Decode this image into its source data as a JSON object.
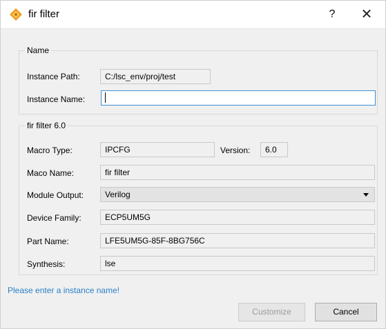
{
  "window": {
    "title": "fir filter",
    "help": "?",
    "close": "✕"
  },
  "name_group": {
    "legend": "Name",
    "instance_path_label": "Instance Path:",
    "instance_path_value": "C:/lsc_env/proj/test",
    "instance_name_label": "Instance Name:",
    "instance_name_value": ""
  },
  "fir_group": {
    "legend": "fir filter 6.0",
    "macro_type_label": "Macro Type:",
    "macro_type_value": "IPCFG",
    "version_label": "Version:",
    "version_value": "6.0",
    "maco_name_label": "Maco Name:",
    "maco_name_value": "fir filter",
    "module_output_label": "Module Output:",
    "module_output_value": "Verilog",
    "device_family_label": "Device Family:",
    "device_family_value": "ECP5UM5G",
    "part_name_label": "Part Name:",
    "part_name_value": "LFE5UM5G-85F-8BG756C",
    "synthesis_label": "Synthesis:",
    "synthesis_value": "lse"
  },
  "status_message": "Please enter a instance name!",
  "buttons": {
    "customize": "Customize",
    "cancel": "Cancel"
  },
  "colors": {
    "accent": "#3c8fd6",
    "message": "#2b80c8",
    "icon_orange": "#f0a020"
  }
}
